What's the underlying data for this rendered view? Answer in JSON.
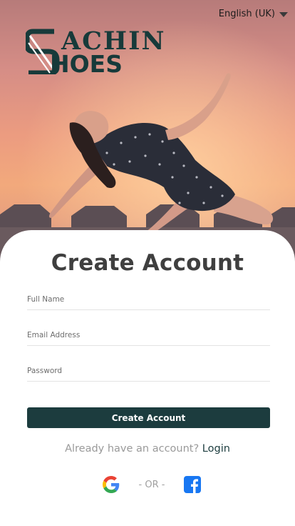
{
  "header": {
    "language": "English (UK)",
    "brand_top": "ACHIN",
    "brand_bottom": "HOES"
  },
  "form": {
    "title": "Create Account",
    "full_name_placeholder": "Full Name",
    "email_placeholder": "Email Address",
    "password_placeholder": "Password",
    "submit_label": "Create Account"
  },
  "footer": {
    "already_text": "Already have an account?",
    "login_label": "Login",
    "divider_text": "- OR -"
  },
  "colors": {
    "brand": "#1c3c3e",
    "title": "#3f3f3f",
    "muted": "#9a9a9a"
  },
  "icons": {
    "language_caret": "caret-down-icon",
    "google": "google-icon",
    "facebook": "facebook-icon"
  }
}
